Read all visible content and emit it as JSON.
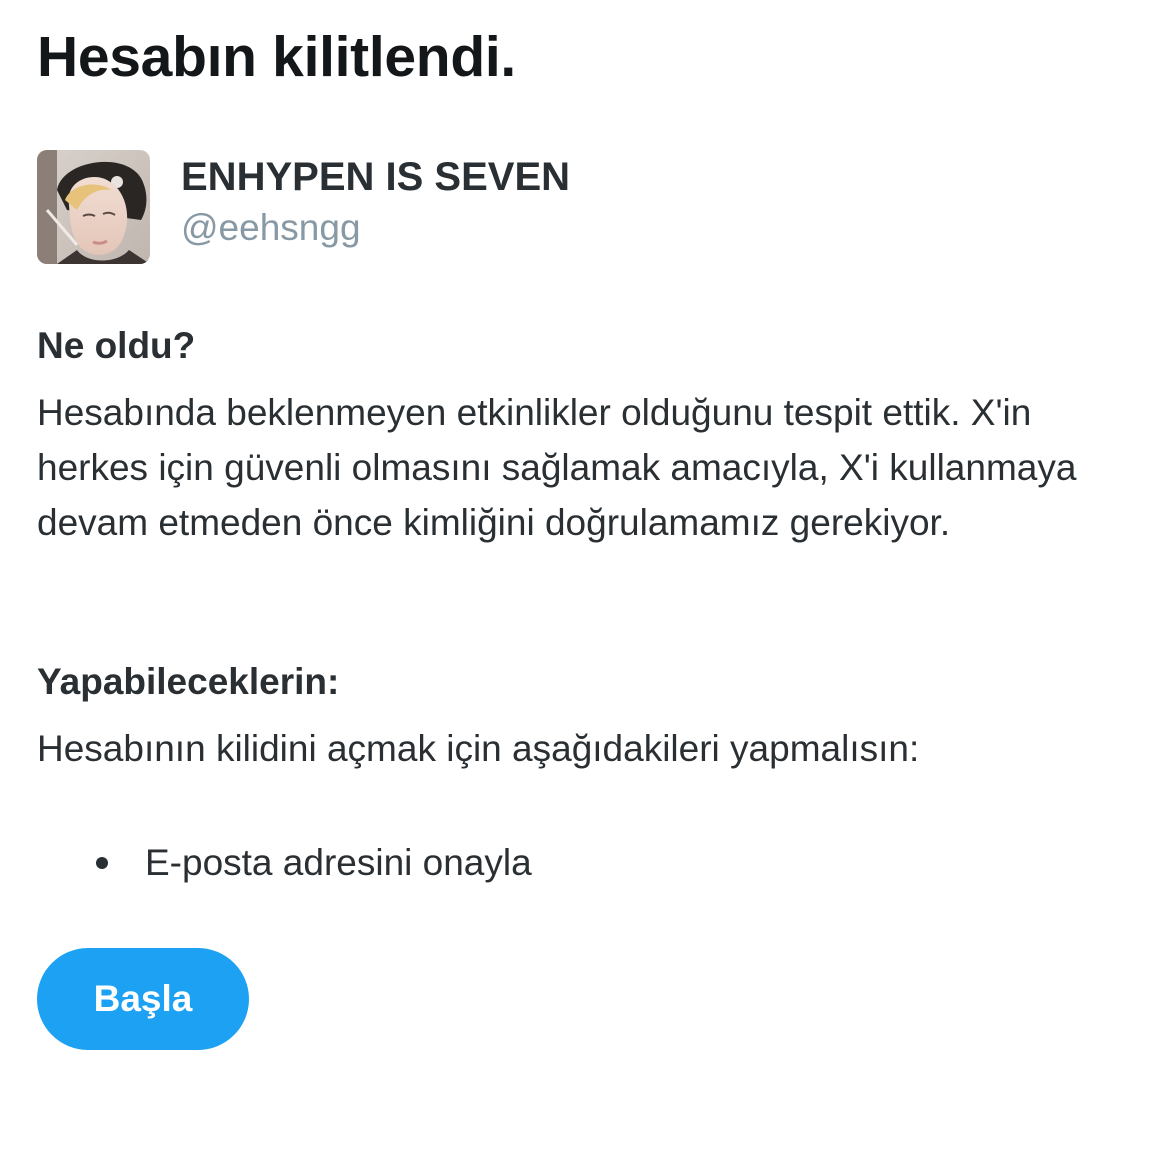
{
  "page": {
    "title": "Hesabın kilitlendi."
  },
  "account": {
    "display_name": "ENHYPEN IS SEVEN",
    "handle": "@eehsngg",
    "avatar_icon": "profile-photo"
  },
  "what_happened": {
    "heading": "Ne oldu?",
    "text": "Hesabında beklenmeyen etkinlikler olduğunu tespit ettik. X'in herkes için güvenli olmasını sağlamak amacıyla, X'i kullanmaya devam etmeden önce kimliğini doğrulamamız gerekiyor."
  },
  "actions": {
    "heading": "Yapabileceklerin:",
    "text": "Hesabının kilidini açmak için aşağıdakileri yapmalısın:",
    "steps": [
      {
        "label": "E-posta adresini onayla"
      }
    ]
  },
  "start_button": {
    "label": "Başla"
  },
  "colors": {
    "accent": "#1da1f2",
    "text_primary": "#14171a",
    "text_secondary": "#8899a6"
  }
}
